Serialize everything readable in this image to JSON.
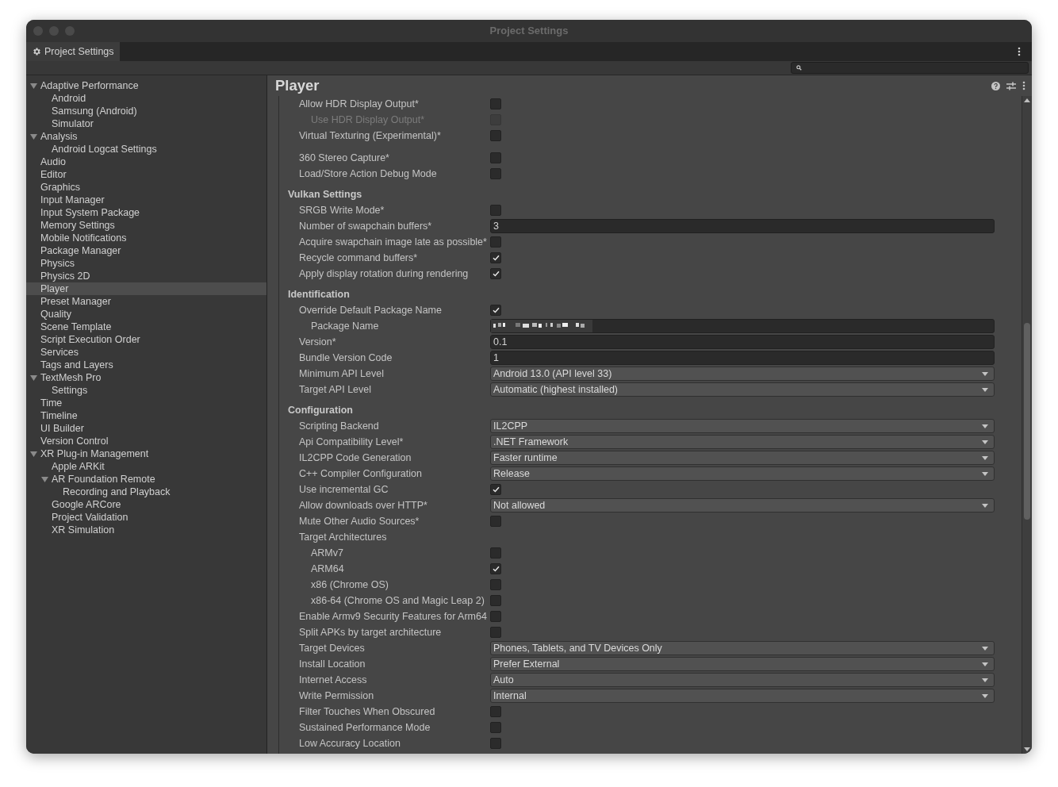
{
  "window": {
    "title": "Project Settings"
  },
  "tab": {
    "label": "Project Settings",
    "selected": true
  },
  "sidebar": {
    "items": [
      {
        "label": "Adaptive Performance",
        "selected": false,
        "expanded": true,
        "children": [
          {
            "label": "Android",
            "selected": false
          },
          {
            "label": "Samsung (Android)",
            "selected": false
          },
          {
            "label": "Simulator",
            "selected": false
          }
        ]
      },
      {
        "label": "Analysis",
        "selected": false,
        "expanded": true,
        "children": [
          {
            "label": "Android Logcat Settings",
            "selected": false
          }
        ]
      },
      {
        "label": "Audio",
        "selected": false
      },
      {
        "label": "Editor",
        "selected": false
      },
      {
        "label": "Graphics",
        "selected": false
      },
      {
        "label": "Input Manager",
        "selected": false
      },
      {
        "label": "Input System Package",
        "selected": false
      },
      {
        "label": "Memory Settings",
        "selected": false
      },
      {
        "label": "Mobile Notifications",
        "selected": false
      },
      {
        "label": "Package Manager",
        "selected": false
      },
      {
        "label": "Physics",
        "selected": false
      },
      {
        "label": "Physics 2D",
        "selected": false
      },
      {
        "label": "Player",
        "selected": true
      },
      {
        "label": "Preset Manager",
        "selected": false
      },
      {
        "label": "Quality",
        "selected": false
      },
      {
        "label": "Scene Template",
        "selected": false
      },
      {
        "label": "Script Execution Order",
        "selected": false
      },
      {
        "label": "Services",
        "selected": false
      },
      {
        "label": "Tags and Layers",
        "selected": false
      },
      {
        "label": "TextMesh Pro",
        "selected": false,
        "expanded": true,
        "children": [
          {
            "label": "Settings",
            "selected": false
          }
        ]
      },
      {
        "label": "Time",
        "selected": false
      },
      {
        "label": "Timeline",
        "selected": false
      },
      {
        "label": "UI Builder",
        "selected": false
      },
      {
        "label": "Version Control",
        "selected": false
      },
      {
        "label": "XR Plug-in Management",
        "selected": false,
        "expanded": true,
        "children": [
          {
            "label": "Apple ARKit",
            "selected": false
          },
          {
            "label": "AR Foundation Remote",
            "selected": false,
            "expanded": true,
            "children": [
              {
                "label": "Recording and Playback",
                "selected": false
              }
            ]
          },
          {
            "label": "Google ARCore",
            "selected": false
          },
          {
            "label": "Project Validation",
            "selected": false
          },
          {
            "label": "XR Simulation",
            "selected": false
          }
        ]
      }
    ]
  },
  "panel": {
    "title": "Player",
    "sections": [
      {
        "rows": [
          {
            "kind": "checkbox",
            "label": "Allow HDR Display Output*",
            "checked": false,
            "children": [
              {
                "kind": "checkbox",
                "label": "Use HDR Display Output*",
                "checked": false,
                "disabled": true
              }
            ]
          },
          {
            "kind": "checkbox",
            "label": "Virtual Texturing (Experimental)*",
            "checked": false
          }
        ]
      },
      {
        "rows": [
          {
            "kind": "checkbox",
            "label": "360 Stereo Capture*",
            "checked": false
          },
          {
            "kind": "checkbox",
            "label": "Load/Store Action Debug Mode",
            "checked": false
          }
        ]
      },
      {
        "title": "Vulkan Settings",
        "rows": [
          {
            "kind": "checkbox",
            "label": "SRGB Write Mode*",
            "checked": false
          },
          {
            "kind": "text",
            "label": "Number of swapchain buffers*",
            "value": "3"
          },
          {
            "kind": "checkbox",
            "label": "Acquire swapchain image late as possible*",
            "checked": false
          },
          {
            "kind": "checkbox",
            "label": "Recycle command buffers*",
            "checked": true
          },
          {
            "kind": "checkbox",
            "label": "Apply display rotation during rendering",
            "checked": true
          }
        ]
      },
      {
        "title": "Identification",
        "rows": [
          {
            "kind": "checkbox",
            "label": "Override Default Package Name",
            "checked": true,
            "children": [
              {
                "kind": "redacted",
                "label": "Package Name"
              }
            ]
          },
          {
            "kind": "text",
            "label": "Version*",
            "value": "0.1"
          },
          {
            "kind": "text",
            "label": "Bundle Version Code",
            "value": "1"
          },
          {
            "kind": "dropdown",
            "label": "Minimum API Level",
            "value": "Android 13.0 (API level 33)"
          },
          {
            "kind": "dropdown",
            "label": "Target API Level",
            "value": "Automatic (highest installed)"
          }
        ]
      },
      {
        "title": "Configuration",
        "rows": [
          {
            "kind": "dropdown",
            "label": "Scripting Backend",
            "value": "IL2CPP"
          },
          {
            "kind": "dropdown",
            "label": "Api Compatibility Level*",
            "value": ".NET Framework"
          },
          {
            "kind": "dropdown",
            "label": "IL2CPP Code Generation",
            "value": "Faster runtime"
          },
          {
            "kind": "dropdown",
            "label": "C++ Compiler Configuration",
            "value": "Release"
          },
          {
            "kind": "checkbox",
            "label": "Use incremental GC",
            "checked": true
          },
          {
            "kind": "dropdown",
            "label": "Allow downloads over HTTP*",
            "value": "Not allowed"
          },
          {
            "kind": "checkbox",
            "label": "Mute Other Audio Sources*",
            "checked": false
          },
          {
            "kind": "label",
            "label": "Target Architectures",
            "children": [
              {
                "kind": "checkbox",
                "label": "ARMv7",
                "checked": false
              },
              {
                "kind": "checkbox",
                "label": "ARM64",
                "checked": true
              },
              {
                "kind": "checkbox",
                "label": "x86 (Chrome OS)",
                "checked": false
              },
              {
                "kind": "checkbox",
                "label": "x86-64 (Chrome OS and Magic Leap 2)",
                "checked": false
              }
            ]
          },
          {
            "kind": "checkbox",
            "label": "Enable Armv9 Security Features for Arm64",
            "checked": false
          },
          {
            "kind": "checkbox",
            "label": "Split APKs by target architecture",
            "checked": false
          },
          {
            "kind": "dropdown",
            "label": "Target Devices",
            "value": "Phones, Tablets, and TV Devices Only"
          },
          {
            "kind": "dropdown",
            "label": "Install Location",
            "value": "Prefer External"
          },
          {
            "kind": "dropdown",
            "label": "Internet Access",
            "value": "Auto"
          },
          {
            "kind": "dropdown",
            "label": "Write Permission",
            "value": "Internal"
          },
          {
            "kind": "checkbox",
            "label": "Filter Touches When Obscured",
            "checked": false
          },
          {
            "kind": "checkbox",
            "label": "Sustained Performance Mode",
            "checked": false
          },
          {
            "kind": "checkbox",
            "label": "Low Accuracy Location",
            "checked": false
          }
        ]
      }
    ]
  }
}
